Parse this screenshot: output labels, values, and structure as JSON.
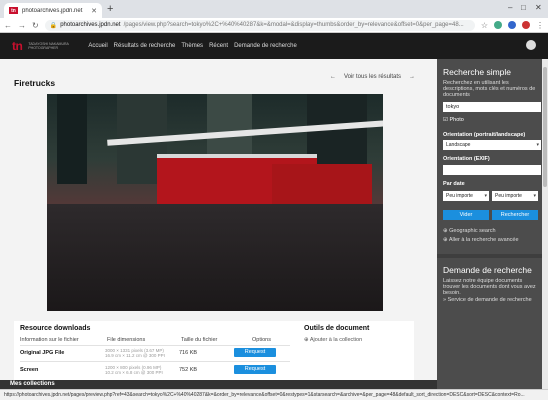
{
  "browser": {
    "tab_title": "photoarchives.jpdn.net",
    "tab_favicon": "tn",
    "url_domain": "photoarchives.jpdn.net",
    "url_path": "/pages/view.php?search=tokyo%2C+%40%40287&k=&modal=&display=thumbs&order_by=relevance&offset=0&per_page=48...",
    "status_url": "https://photoarchives.jpdn.net/pages/preview.php?ref=43&search=tokyo%2C+%40%40287&k=&order_by=relevance&offset=0&restypes=1&starsearch=&archive=&per_page=48&default_sort_direction=DESC&sort=DESC&context=Ro..."
  },
  "site": {
    "logo": "tn",
    "logo_sub_1": "TADAYOSHI NAKAMURA",
    "logo_sub_2": "PHOTOGRAPHER",
    "menu": [
      "Accueil",
      "Résultats de recherche",
      "Thèmes",
      "Récent",
      "Demande de recherche"
    ]
  },
  "main": {
    "title": "Firetrucks",
    "prev_next": "Voir tous les résultats",
    "resource_downloads": "Resource downloads",
    "headers": {
      "info": "Information sur le fichier",
      "dims": "File dimensions",
      "size": "Taille du fichier",
      "options": "Options"
    },
    "rows": [
      {
        "label": "Original JPG File",
        "dim1": "3000 × 1331 pixels (3.67 MP)",
        "dim2": "16.9 cm × 11.2 cm @ 300 PPI",
        "size": "716 KB",
        "button": "Request"
      },
      {
        "label": "Screen",
        "dim1": "1200 × 800 pixels (0.96 MP)",
        "dim2": "10.2 cm × 6.8 cm @ 300 PPI",
        "size": "752 KB",
        "button": "Request"
      }
    ],
    "outils": "Outils de document",
    "ajout": "Ajouter à la collection",
    "bottom": "Mes collections"
  },
  "sidebar": {
    "simple_title": "Recherche simple",
    "simple_desc": "Recherchez en utilisant les descriptions, mots clés et numéros de documents",
    "search_value": "tokyo",
    "photo_label": "Photo",
    "orient_label": "Orientation (portrait/landscape)",
    "orient_value": "Landscape",
    "exif_label": "Orientation (EXIF)",
    "date_label": "Par date",
    "date_from": "Peu importe",
    "date_to": "Peu importe",
    "clear_btn": "Vider",
    "search_btn": "Rechercher",
    "geo": "Geographic search",
    "advanced": "Aller à la recherche avancée",
    "demande_title": "Demande de recherche",
    "demande_desc": "Laissez notre équipe documents trouver les documents dont vous avez besoin.",
    "service": "» Service de demande de recherche"
  }
}
